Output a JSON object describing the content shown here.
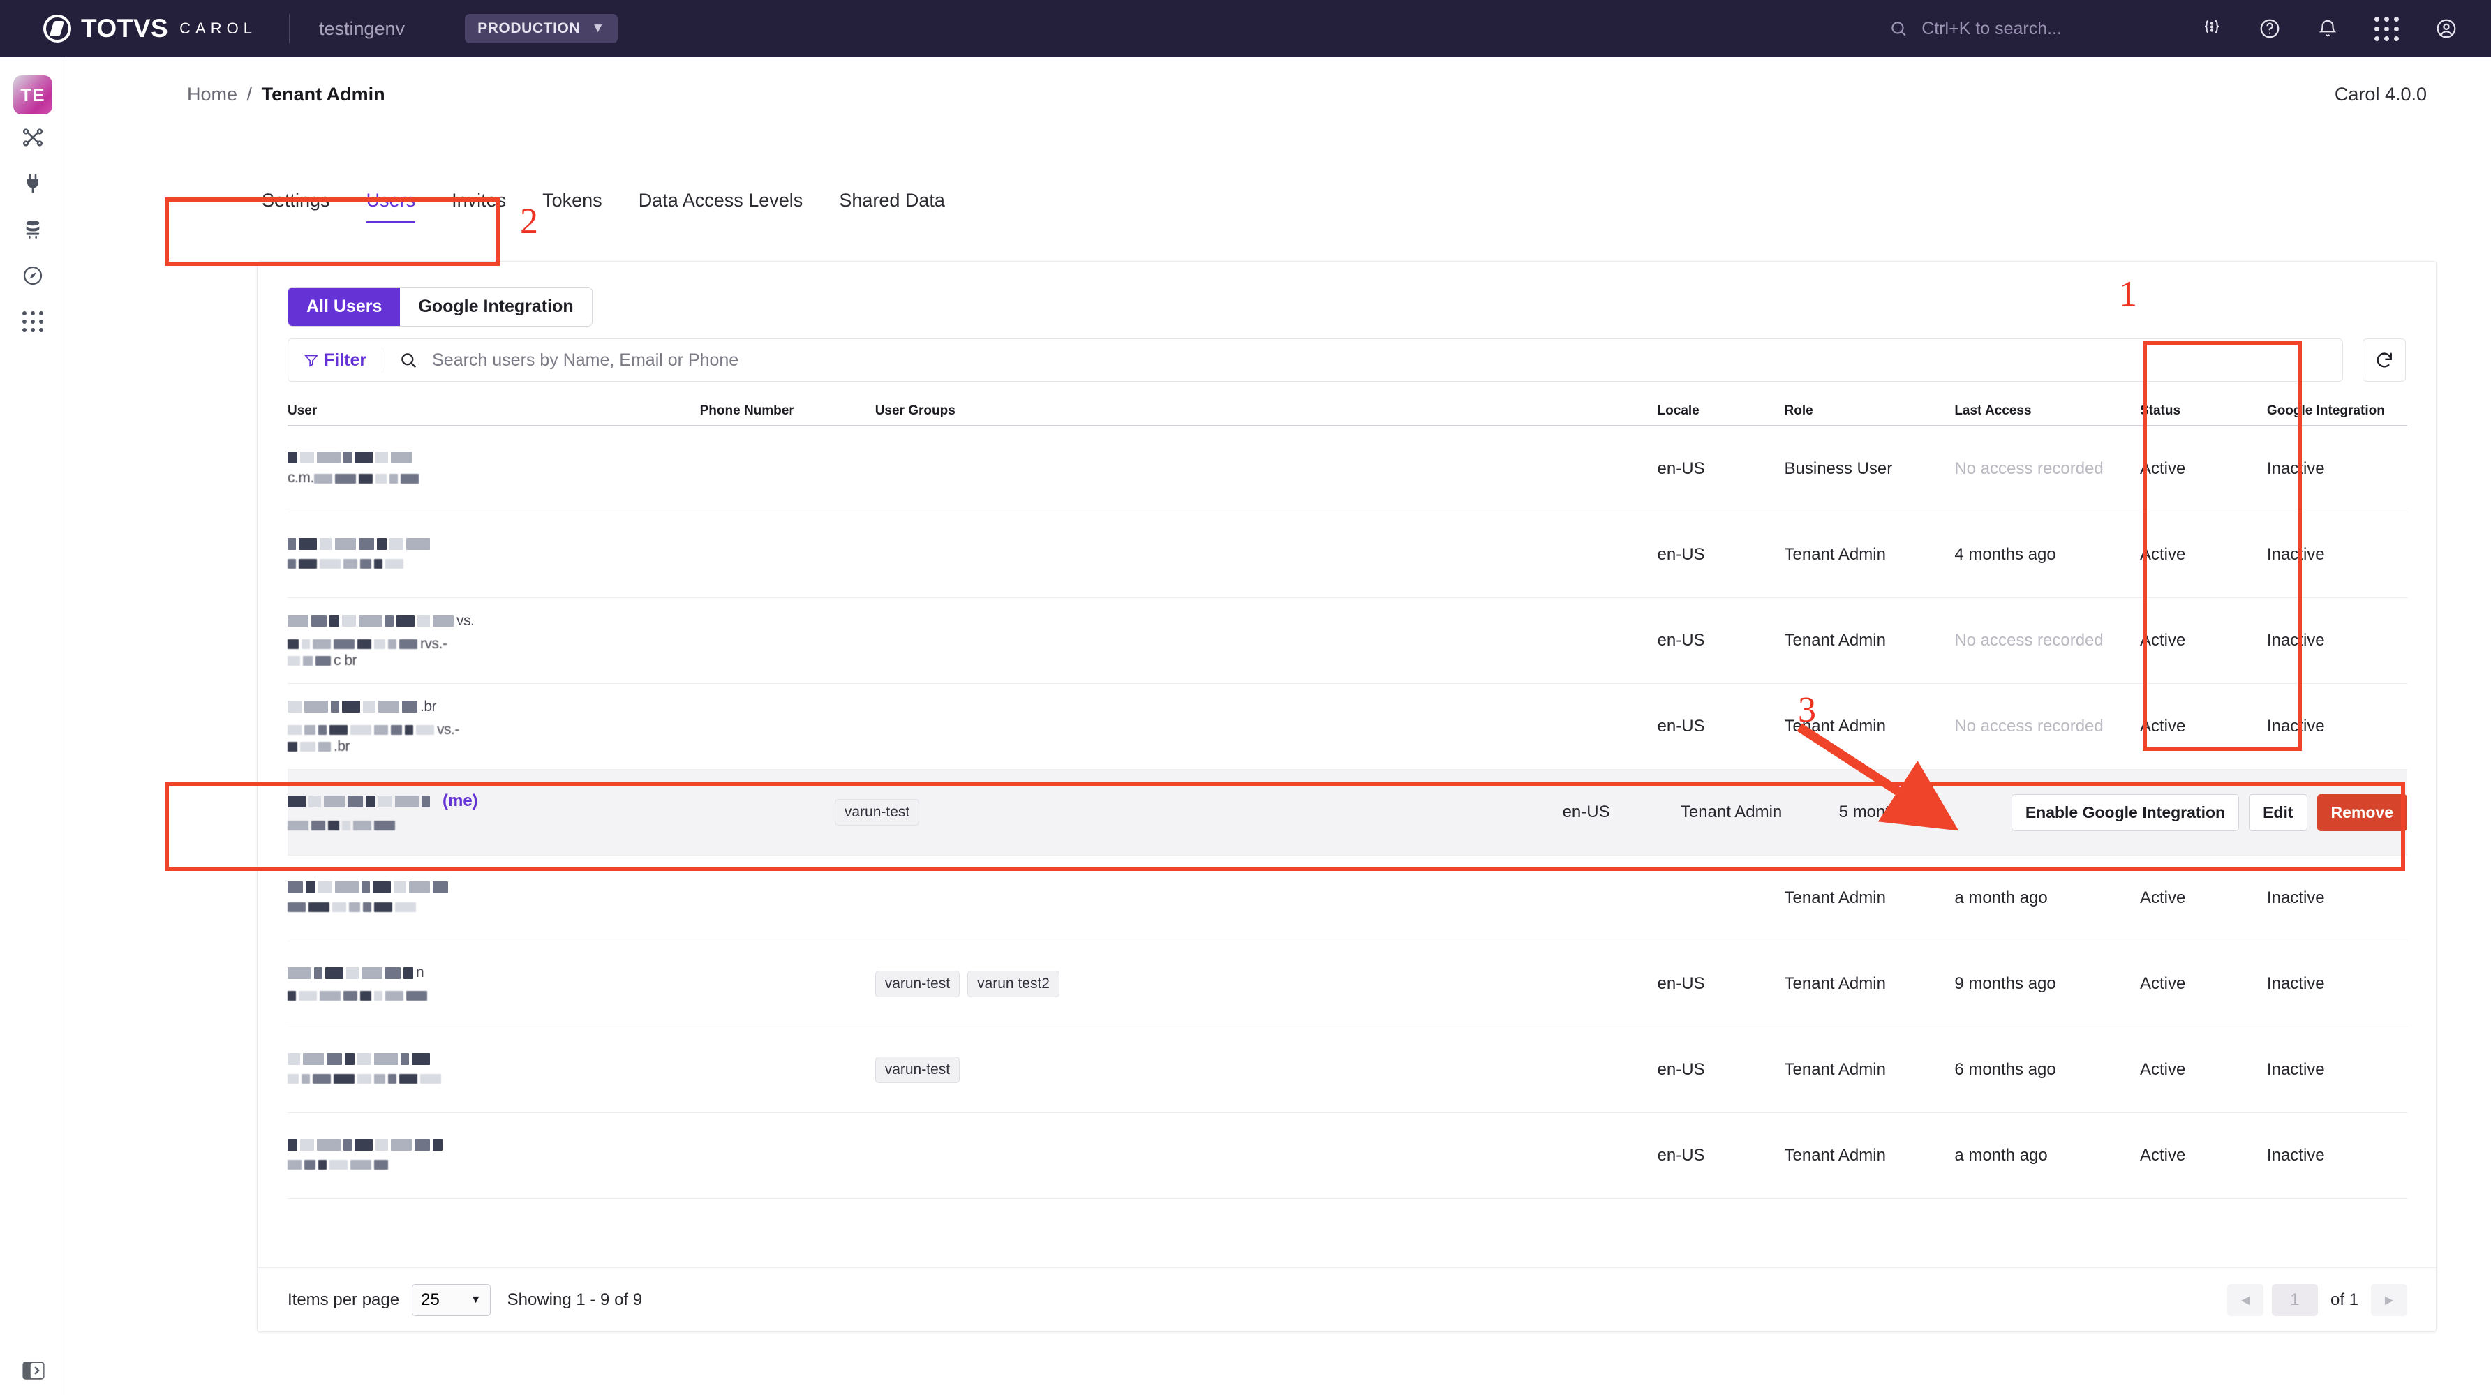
{
  "topbar": {
    "brand_totvs": "TOTVS",
    "brand_carol": "CAROL",
    "env_name": "testingenv",
    "env_badge": "PRODUCTION",
    "search_placeholder": "Ctrl+K to search...",
    "icons": [
      "search-icon",
      "code-braces-icon",
      "help-circle-icon",
      "bell-icon",
      "apps-grid-icon",
      "account-circle-icon"
    ]
  },
  "rail": {
    "avatar_label": "TE",
    "items": [
      "pipeline-icon",
      "plug-icon",
      "database-icon",
      "compass-icon",
      "apps-grid-icon"
    ],
    "bottom_item": "expand-panel-icon"
  },
  "page": {
    "breadcrumb_home": "Home",
    "breadcrumb_sep": "/",
    "breadcrumb_current": "Tenant Admin",
    "version": "Carol 4.0.0"
  },
  "tabs": [
    {
      "label": "Settings",
      "active": false
    },
    {
      "label": "Users",
      "active": true
    },
    {
      "label": "Invites",
      "active": false
    },
    {
      "label": "Tokens",
      "active": false
    },
    {
      "label": "Data Access Levels",
      "active": false
    },
    {
      "label": "Shared Data",
      "active": false
    }
  ],
  "segmented": [
    {
      "label": "All Users",
      "active": true
    },
    {
      "label": "Google Integration",
      "active": false
    }
  ],
  "toolbar": {
    "filter_label": "Filter",
    "search_placeholder": "Search users by Name, Email or Phone",
    "refresh_label": "refresh-icon"
  },
  "table": {
    "columns": [
      "User",
      "Phone Number",
      "User Groups",
      "Locale",
      "Role",
      "Last Access",
      "Status",
      "Google Integration"
    ],
    "rows": [
      {
        "name_redacted": true,
        "name_suffix": "",
        "is_me": false,
        "email_fragment": "c.m.",
        "email_fragment2": "",
        "phone": "",
        "groups": [],
        "locale": "en-US",
        "role": "Business User",
        "last_access": "No access recorded",
        "last_access_muted": true,
        "status": "Active",
        "google_integration": "Inactive",
        "highlighted": false
      },
      {
        "name_redacted": true,
        "name_suffix": "",
        "is_me": false,
        "email_fragment": "",
        "email_fragment2": "",
        "phone": "",
        "groups": [],
        "locale": "en-US",
        "role": "Tenant Admin",
        "last_access": "4 months ago",
        "last_access_muted": false,
        "status": "Active",
        "google_integration": "Inactive",
        "highlighted": false
      },
      {
        "name_redacted": true,
        "name_suffix": "vs.",
        "is_me": false,
        "email_fragment": "rvs.-",
        "email_fragment2": "c   br",
        "phone": "",
        "groups": [],
        "locale": "en-US",
        "role": "Tenant Admin",
        "last_access": "No access recorded",
        "last_access_muted": true,
        "status": "Active",
        "google_integration": "Inactive",
        "highlighted": false
      },
      {
        "name_redacted": true,
        "name_suffix": ".br",
        "is_me": false,
        "email_fragment": "vs.-",
        "email_fragment2": ".br",
        "phone": "",
        "groups": [],
        "locale": "en-US",
        "role": "Tenant Admin",
        "last_access": "No access recorded",
        "last_access_muted": true,
        "status": "Active",
        "google_integration": "Inactive",
        "highlighted": false
      },
      {
        "name_redacted": true,
        "name_suffix": "",
        "is_me": true,
        "me_label": "(me)",
        "email_fragment": "",
        "email_fragment2": "",
        "phone": "",
        "groups": [
          "varun-test"
        ],
        "locale": "en-US",
        "role": "Tenant Admin",
        "last_access": "5 months ago",
        "last_access_muted": false,
        "status": "",
        "google_integration": "",
        "highlighted": true,
        "actions": [
          {
            "label": "Enable Google Integration",
            "style": "white"
          },
          {
            "label": "Edit",
            "style": "white"
          },
          {
            "label": "Remove",
            "style": "red"
          }
        ]
      },
      {
        "name_redacted": true,
        "name_suffix": "",
        "is_me": false,
        "email_fragment": "",
        "email_fragment2": "",
        "phone": "",
        "groups": [],
        "locale": "",
        "role": "Tenant Admin",
        "last_access": "a month ago",
        "last_access_muted": false,
        "status": "Active",
        "google_integration": "Inactive",
        "highlighted": false
      },
      {
        "name_redacted": true,
        "name_suffix": "n",
        "is_me": false,
        "email_fragment": "",
        "email_fragment2": "",
        "phone": "",
        "groups": [
          "varun-test",
          "varun test2"
        ],
        "locale": "en-US",
        "role": "Tenant Admin",
        "last_access": "9 months ago",
        "last_access_muted": false,
        "status": "Active",
        "google_integration": "Inactive",
        "highlighted": false
      },
      {
        "name_redacted": true,
        "name_suffix": "",
        "is_me": false,
        "email_fragment": "",
        "email_fragment2": "",
        "phone": "",
        "groups": [
          "varun-test"
        ],
        "locale": "en-US",
        "role": "Tenant Admin",
        "last_access": "6 months ago",
        "last_access_muted": false,
        "status": "Active",
        "google_integration": "Inactive",
        "highlighted": false
      },
      {
        "name_redacted": true,
        "name_suffix": "",
        "is_me": false,
        "email_fragment": "",
        "email_fragment2": "",
        "phone": "",
        "groups": [],
        "locale": "en-US",
        "role": "Tenant Admin",
        "last_access": "a month ago",
        "last_access_muted": false,
        "status": "Active",
        "google_integration": "Inactive",
        "highlighted": false
      }
    ]
  },
  "footer": {
    "items_per_page_label": "Items per page",
    "items_per_page_value": "25",
    "showing": "Showing 1 - 9 of 9",
    "page_value": "1",
    "page_of": "of 1"
  },
  "annotations": [
    {
      "label": "1"
    },
    {
      "label": "2"
    },
    {
      "label": "3"
    }
  ],
  "colors": {
    "accent_purple": "#6532d6",
    "annotation_red": "#f0442a",
    "danger_red": "#d6452b",
    "topbar_bg": "#241f3a"
  }
}
